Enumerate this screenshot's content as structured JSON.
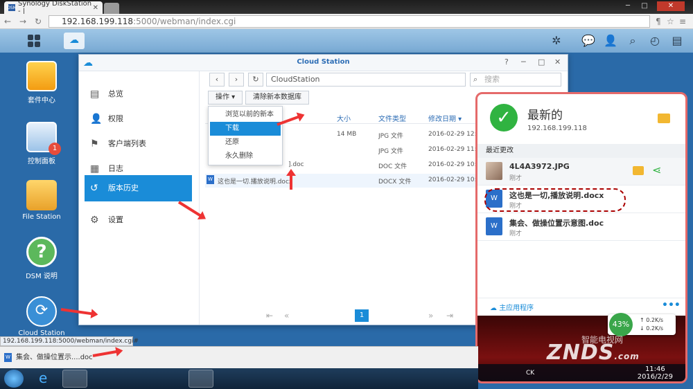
{
  "browser": {
    "tab_title": "Synology DiskStation - |",
    "tab_favicon": "DSM",
    "url_host": "192.168.199.118",
    "url_path": ":5000/webman/index.cgi",
    "status_url": "192.168.199.118:5000/webman/index.cgi#"
  },
  "desktop": {
    "icons": [
      {
        "label": "套件中心"
      },
      {
        "label": "控制面板",
        "badge": "1"
      },
      {
        "label": "File Station"
      },
      {
        "label": "DSM 说明"
      },
      {
        "label": "Cloud Station"
      }
    ]
  },
  "window": {
    "title": "Cloud Station",
    "sidebar": [
      {
        "label": "总览",
        "icon": "overview-icon"
      },
      {
        "label": "权限",
        "icon": "user-icon"
      },
      {
        "label": "客户端列表",
        "icon": "client-list-icon"
      },
      {
        "label": "日志",
        "icon": "log-icon"
      },
      {
        "label": "版本历史",
        "icon": "history-icon",
        "active": true
      },
      {
        "label": "设置",
        "icon": "gear-icon"
      }
    ],
    "path": "CloudStation",
    "search_placeholder": "搜索",
    "toolbar": {
      "action": "操作",
      "clear_db": "清除新本数据库"
    },
    "columns": [
      "大小",
      "文件类型",
      "修改日期"
    ],
    "rows": [
      {
        "name": "",
        "size": "14 MB",
        "type": "JPG 文件",
        "date": "2016-02-29 12:19"
      },
      {
        "name": "",
        "size": "",
        "type": "JPG 文件",
        "date": "2016-02-29 11:45"
      },
      {
        "name": "].doc",
        "size": "",
        "type": "DOC 文件",
        "date": "2016-02-29 10:39"
      },
      {
        "name": "这也是一切.播放说明.docx",
        "size": "",
        "type": "DOCX 文件",
        "date": "2016-02-29 10:39"
      }
    ],
    "menu": [
      "浏览以前的新本",
      "下载",
      "还原",
      "永久删除"
    ],
    "page": "1"
  },
  "notify": {
    "status": "最新的",
    "ip": "192.168.199.118",
    "recent_label": "最近更改",
    "items": [
      {
        "name": "4L4A3972.JPG",
        "time": "刚才"
      },
      {
        "name": "这也是一切,播放说明.docx",
        "time": "刚才"
      },
      {
        "name": "集会、做操位置示意图.doc",
        "time": "刚才"
      }
    ],
    "main_app": "主应用程序",
    "net_pct": "43%",
    "net_up": "0.2K/s",
    "net_down": "0.2K/s",
    "watermark": "ZNDS",
    "watermark_cn": "智能电视网",
    "watermark_com": ".com",
    "tray_lang": "CK",
    "clock_time": "11:46",
    "clock_date": "2016/2/29"
  },
  "download": {
    "file": "集会、做操位置示....doc"
  }
}
